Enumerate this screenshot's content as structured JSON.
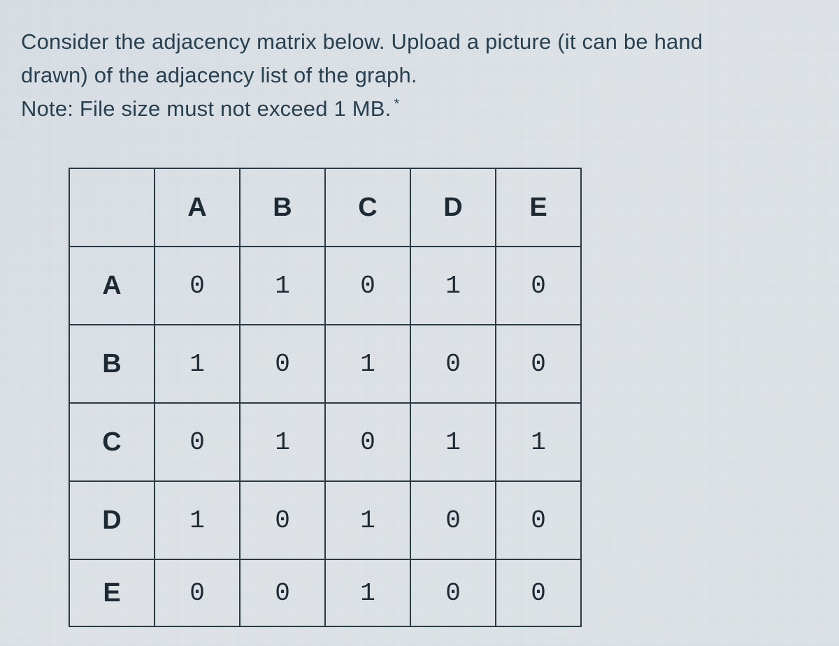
{
  "question": {
    "line1": "Consider the adjacency matrix below. Upload a picture (it can be hand",
    "line2": "drawn) of the adjacency list of the graph.",
    "line3": "Note: File size must not exceed 1 MB.",
    "required_mark": "*"
  },
  "matrix": {
    "col_headers": [
      "A",
      "B",
      "C",
      "D",
      "E"
    ],
    "row_headers": [
      "A",
      "B",
      "C",
      "D",
      "E"
    ],
    "rows": [
      [
        "0",
        "1",
        "0",
        "1",
        "0"
      ],
      [
        "1",
        "0",
        "1",
        "0",
        "0"
      ],
      [
        "0",
        "1",
        "0",
        "1",
        "1"
      ],
      [
        "1",
        "0",
        "1",
        "0",
        "0"
      ],
      [
        "0",
        "0",
        "1",
        "0",
        "0"
      ]
    ]
  },
  "chart_data": {
    "type": "table",
    "title": "Adjacency Matrix",
    "columns": [
      "A",
      "B",
      "C",
      "D",
      "E"
    ],
    "rows": [
      "A",
      "B",
      "C",
      "D",
      "E"
    ],
    "values": [
      [
        0,
        1,
        0,
        1,
        0
      ],
      [
        1,
        0,
        1,
        0,
        0
      ],
      [
        0,
        1,
        0,
        1,
        1
      ],
      [
        1,
        0,
        1,
        0,
        0
      ],
      [
        0,
        0,
        1,
        0,
        0
      ]
    ]
  }
}
